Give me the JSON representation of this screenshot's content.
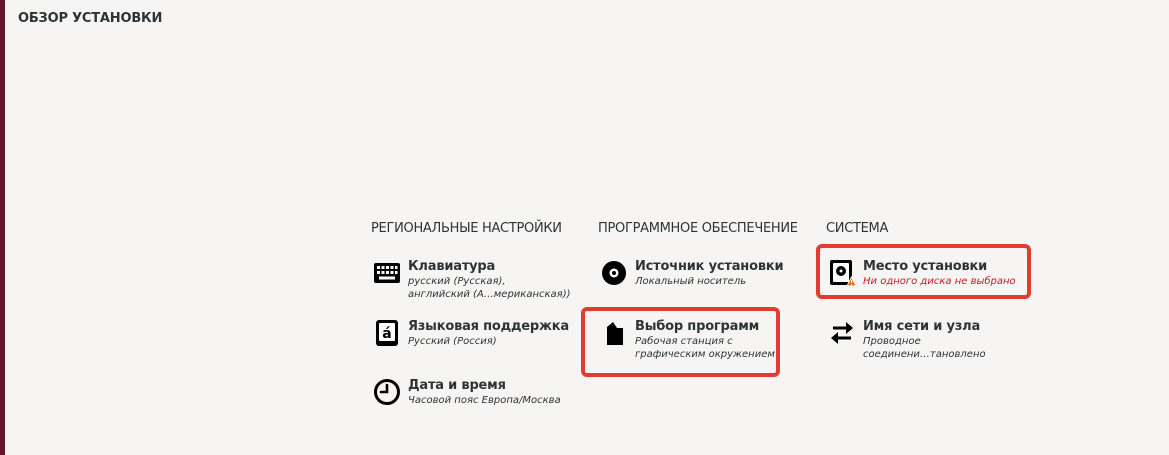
{
  "page": {
    "title": "ОБЗОР УСТАНОВКИ"
  },
  "colors": {
    "accent_left": "#60192b",
    "warning": "#c01c28",
    "highlight": "#e03c31",
    "background": "#f6f5f4"
  },
  "columns": {
    "localization": {
      "title": "РЕГИОНАЛЬНЫЕ НАСТРОЙКИ",
      "spokes": [
        {
          "name": "Клавиатура",
          "status": [
            "русский (Русская),",
            "английский (А…мериканская))"
          ],
          "icon": "keyboard-icon"
        },
        {
          "name": "Языковая поддержка",
          "status": [
            "Русский (Россия)"
          ],
          "icon": "language-icon"
        },
        {
          "name": "Дата и время",
          "status": [
            "Часовой пояс Европа/Москва"
          ],
          "icon": "clock-icon"
        }
      ]
    },
    "software": {
      "title": "ПРОГРАММНОЕ ОБЕСПЕЧЕНИЕ",
      "spokes": [
        {
          "name": "Источник установки",
          "status": [
            "Локальный носитель"
          ],
          "icon": "disc-icon"
        },
        {
          "name": "Выбор программ",
          "status": [
            "Рабочая станция с",
            "графическим окружением"
          ],
          "icon": "package-icon"
        }
      ]
    },
    "system": {
      "title": "СИСТЕМА",
      "spokes": [
        {
          "name": "Место установки",
          "status": [
            "Ни одного диска не выбрано"
          ],
          "icon": "harddisk-warning-icon"
        },
        {
          "name": "Имя сети и узла",
          "status": [
            "Проводное",
            "соединени…тановлено"
          ],
          "icon": "network-arrows-icon"
        }
      ]
    }
  }
}
